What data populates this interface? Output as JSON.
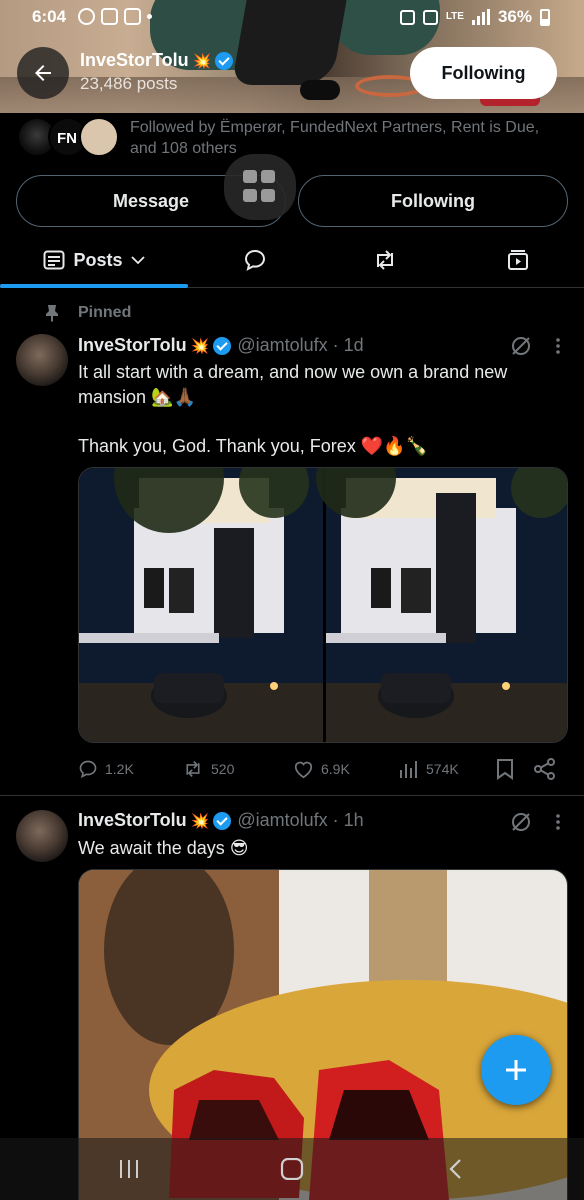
{
  "status_bar": {
    "time": "6:04",
    "network": "LTE",
    "battery": "36%"
  },
  "header": {
    "name": "InveStorTolu",
    "posts_count": "23,486 posts",
    "follow_button": "Following"
  },
  "profile": {
    "followed_by": "Followed by Ëmperør, FundedNext Partners, Rent is Due, and 108 others",
    "message_button": "Message",
    "following_button": "Following"
  },
  "tabs": {
    "posts": "Posts",
    "replies_icon": "speech-bubble-icon",
    "reposts_icon": "repost-icon",
    "media_icon": "media-icon"
  },
  "posts": [
    {
      "pinned_label": "Pinned",
      "name": "InveStorTolu",
      "handle_time": "@iamtolufx · 1d",
      "text_line1": "It all start with a dream, and now we own a brand new mansion 🏡🙏🏾",
      "text_line2": "Thank you, God. Thank you, Forex ❤️🔥🍾",
      "replies": "1.2K",
      "reposts": "520",
      "likes": "6.9K",
      "views": "574K"
    },
    {
      "name": "InveStorTolu",
      "handle_time": "@iamtolufx · 1h",
      "text": "We await the days 😎"
    }
  ],
  "colors": {
    "accent": "#1d9bf0",
    "background": "#000000",
    "muted_text": "#71767b",
    "border": "#2f3336"
  }
}
